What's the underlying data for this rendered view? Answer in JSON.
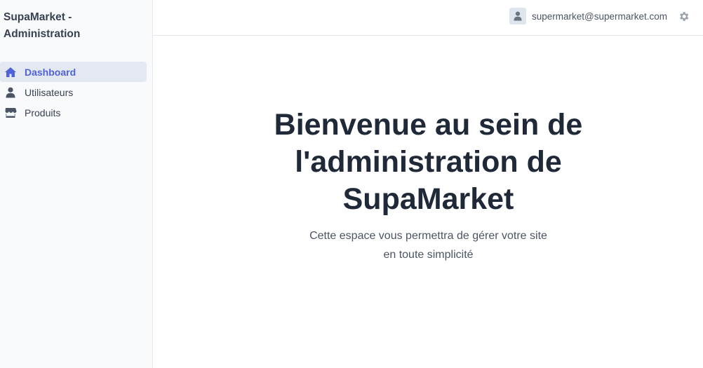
{
  "app": {
    "brand": "SupaMarket - Administration"
  },
  "sidebar": {
    "items": [
      {
        "label": "Dashboard",
        "icon": "home-icon",
        "active": true
      },
      {
        "label": "Utilisateurs",
        "icon": "user-icon",
        "active": false
      },
      {
        "label": "Produits",
        "icon": "store-icon",
        "active": false
      }
    ]
  },
  "header": {
    "email": "supermarket@supermarket.com",
    "avatar_icon": "user-avatar-icon",
    "settings_icon": "gear-icon"
  },
  "main": {
    "title": "Bienvenue au sein de l'administration de SupaMarket",
    "subtitle": "Cette espace vous permettra de gérer votre site en toute simplicité"
  },
  "colors": {
    "accent": "#4f63d8",
    "active_bg": "#e3e8f1",
    "sidebar_bg": "#f8fafc",
    "title_text": "#1f2937"
  }
}
